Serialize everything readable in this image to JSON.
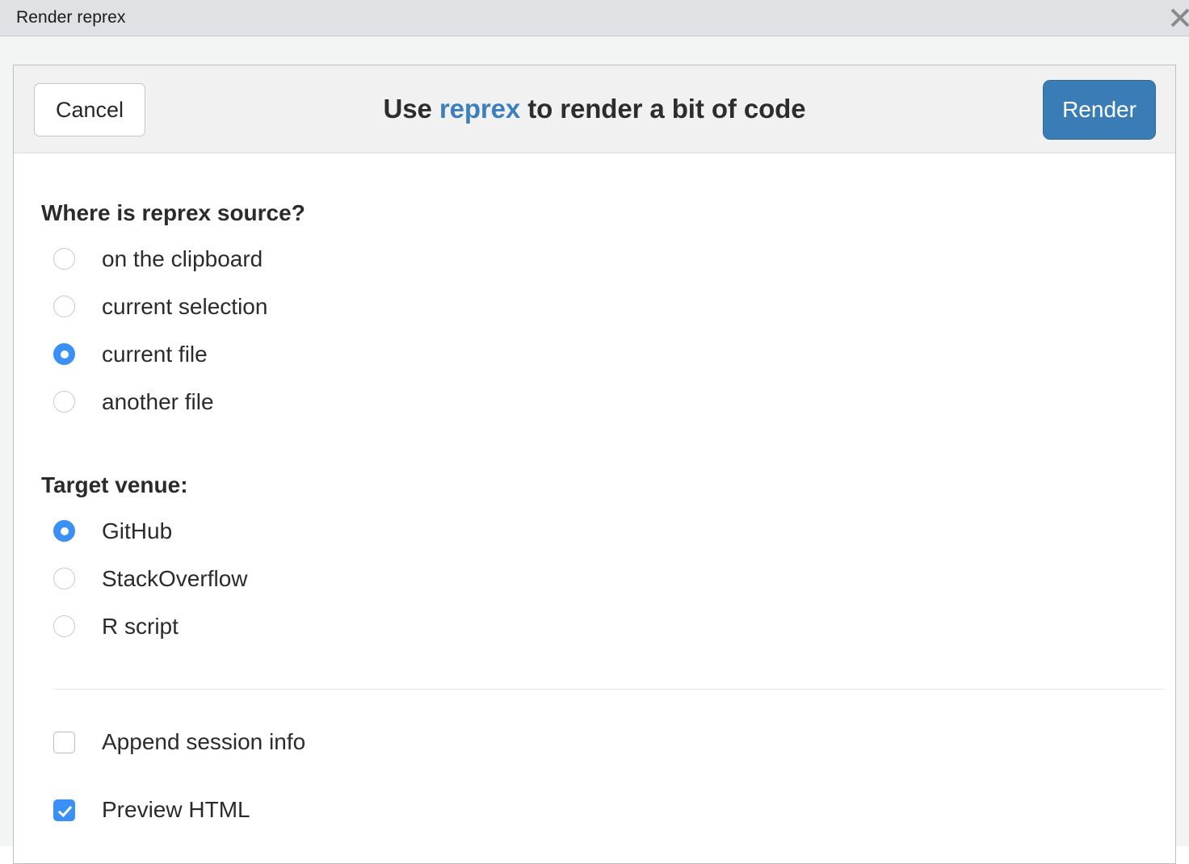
{
  "window": {
    "title": "Render reprex",
    "close_icon": "close-icon"
  },
  "header": {
    "cancel_label": "Cancel",
    "render_label": "Render",
    "title_prefix": "Use ",
    "title_accent": "reprex",
    "title_suffix": " to render a bit of code",
    "accent_color": "#3d7fbd",
    "render_button_color": "#3a7cb5"
  },
  "source": {
    "heading": "Where is reprex source?",
    "options": [
      {
        "label": "on the clipboard",
        "selected": false
      },
      {
        "label": "current selection",
        "selected": false
      },
      {
        "label": "current file",
        "selected": true
      },
      {
        "label": "another file",
        "selected": false
      }
    ]
  },
  "venue": {
    "heading": "Target venue:",
    "options": [
      {
        "label": "GitHub",
        "selected": true
      },
      {
        "label": "StackOverflow",
        "selected": false
      },
      {
        "label": "R script",
        "selected": false
      }
    ]
  },
  "toggles": {
    "items": [
      {
        "label": "Append session info",
        "checked": false
      },
      {
        "label": "Preview HTML",
        "checked": true
      }
    ]
  },
  "colors": {
    "selected_control": "#3b90f5",
    "titlebar_bg": "#dfe1e5",
    "panel_header_bg": "#f1f1f1",
    "text": "#2b2b2b"
  }
}
